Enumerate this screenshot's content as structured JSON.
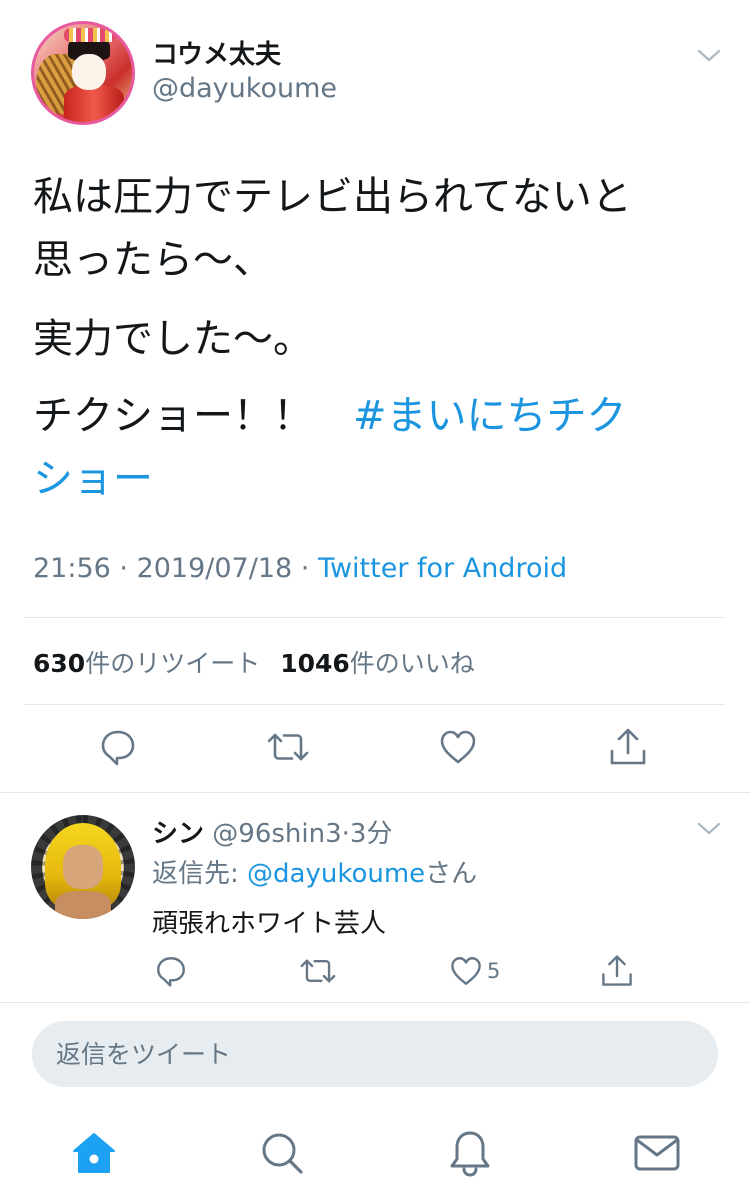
{
  "tweet": {
    "author_name": "コウメ太夫",
    "author_handle": "@dayukoume",
    "text_line_1": "私は圧力でテレビ出られてないと",
    "text_line_2": "思ったら〜、",
    "text_line_3": "実力でした〜。",
    "text_line_4_plain": "チクショー！！　",
    "text_line_4_hashtag": "#まいにちチク",
    "text_line_5_hashtag": "ショー",
    "time": "21:56",
    "date": "2019/07/18",
    "separator": " · ",
    "source": "Twitter for Android",
    "retweet_count": "630",
    "retweet_label": "件のリツイート",
    "like_count": "1046",
    "like_label": "件のいいね"
  },
  "reply": {
    "author_name": "シン",
    "author_handle": "@96shin3",
    "time_ago": "3分",
    "reply_to_label": "返信先: ",
    "reply_to_handle": "@dayukoume",
    "reply_to_suffix": "さん",
    "text": "頑張れホワイト芸人",
    "like_count": "5"
  },
  "composer": {
    "placeholder": "返信をツイート"
  },
  "colors": {
    "accent": "#1b95e0",
    "nav_active": "#1da1f2",
    "secondary_text": "#657786",
    "primary_text": "#14171a",
    "divider": "#e1e8ed",
    "input_bg": "#e6ecf0"
  },
  "icons": {
    "main_actions": [
      "reply-icon",
      "retweet-icon",
      "like-icon",
      "share-icon"
    ],
    "nav": [
      "home-icon",
      "search-icon",
      "notifications-icon",
      "messages-icon"
    ]
  }
}
